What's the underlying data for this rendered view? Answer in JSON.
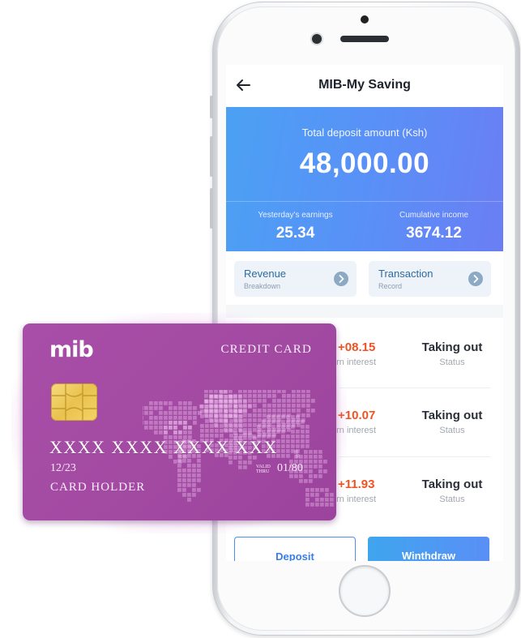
{
  "screen": {
    "title": "MIB-My Saving"
  },
  "hero": {
    "label": "Total deposit amount (Ksh)",
    "amount": "48,000.00",
    "stats": [
      {
        "label": "Yesterday's earnings",
        "value": "25.34"
      },
      {
        "label": "Cumulative income",
        "value": "3674.12"
      }
    ]
  },
  "actions": [
    {
      "title": "Revenue",
      "subtitle": "Breakdown"
    },
    {
      "title": "Transaction",
      "subtitle": "Record"
    }
  ],
  "transactions": [
    {
      "amount": "+08.15",
      "amount_label": "arn interest",
      "status": "Taking out",
      "status_label": "Status"
    },
    {
      "amount": "+10.07",
      "amount_label": "arn interest",
      "status": "Taking out",
      "status_label": "Status"
    },
    {
      "amount": "+11.93",
      "amount_label": "arn interest",
      "status": "Taking out",
      "status_label": "Status"
    }
  ],
  "buttons": {
    "deposit": "Deposit",
    "withdraw": "Winthdraw"
  },
  "card": {
    "logo": "mib",
    "type": "CREDIT CARD",
    "number": "XXXX XXXX XXXX XXX",
    "expiry": "12/23",
    "valid_thru_label": "VALID THRU",
    "valid_thru": "01/80",
    "holder": "CARD HOLDER"
  },
  "colors": {
    "accent_blue": "#4b8df4",
    "positive_amount": "#f05323",
    "card_purple": "#a34aa3"
  },
  "icons": {
    "back": "back-arrow-icon",
    "action_arrow": "chevron-right-icon"
  }
}
